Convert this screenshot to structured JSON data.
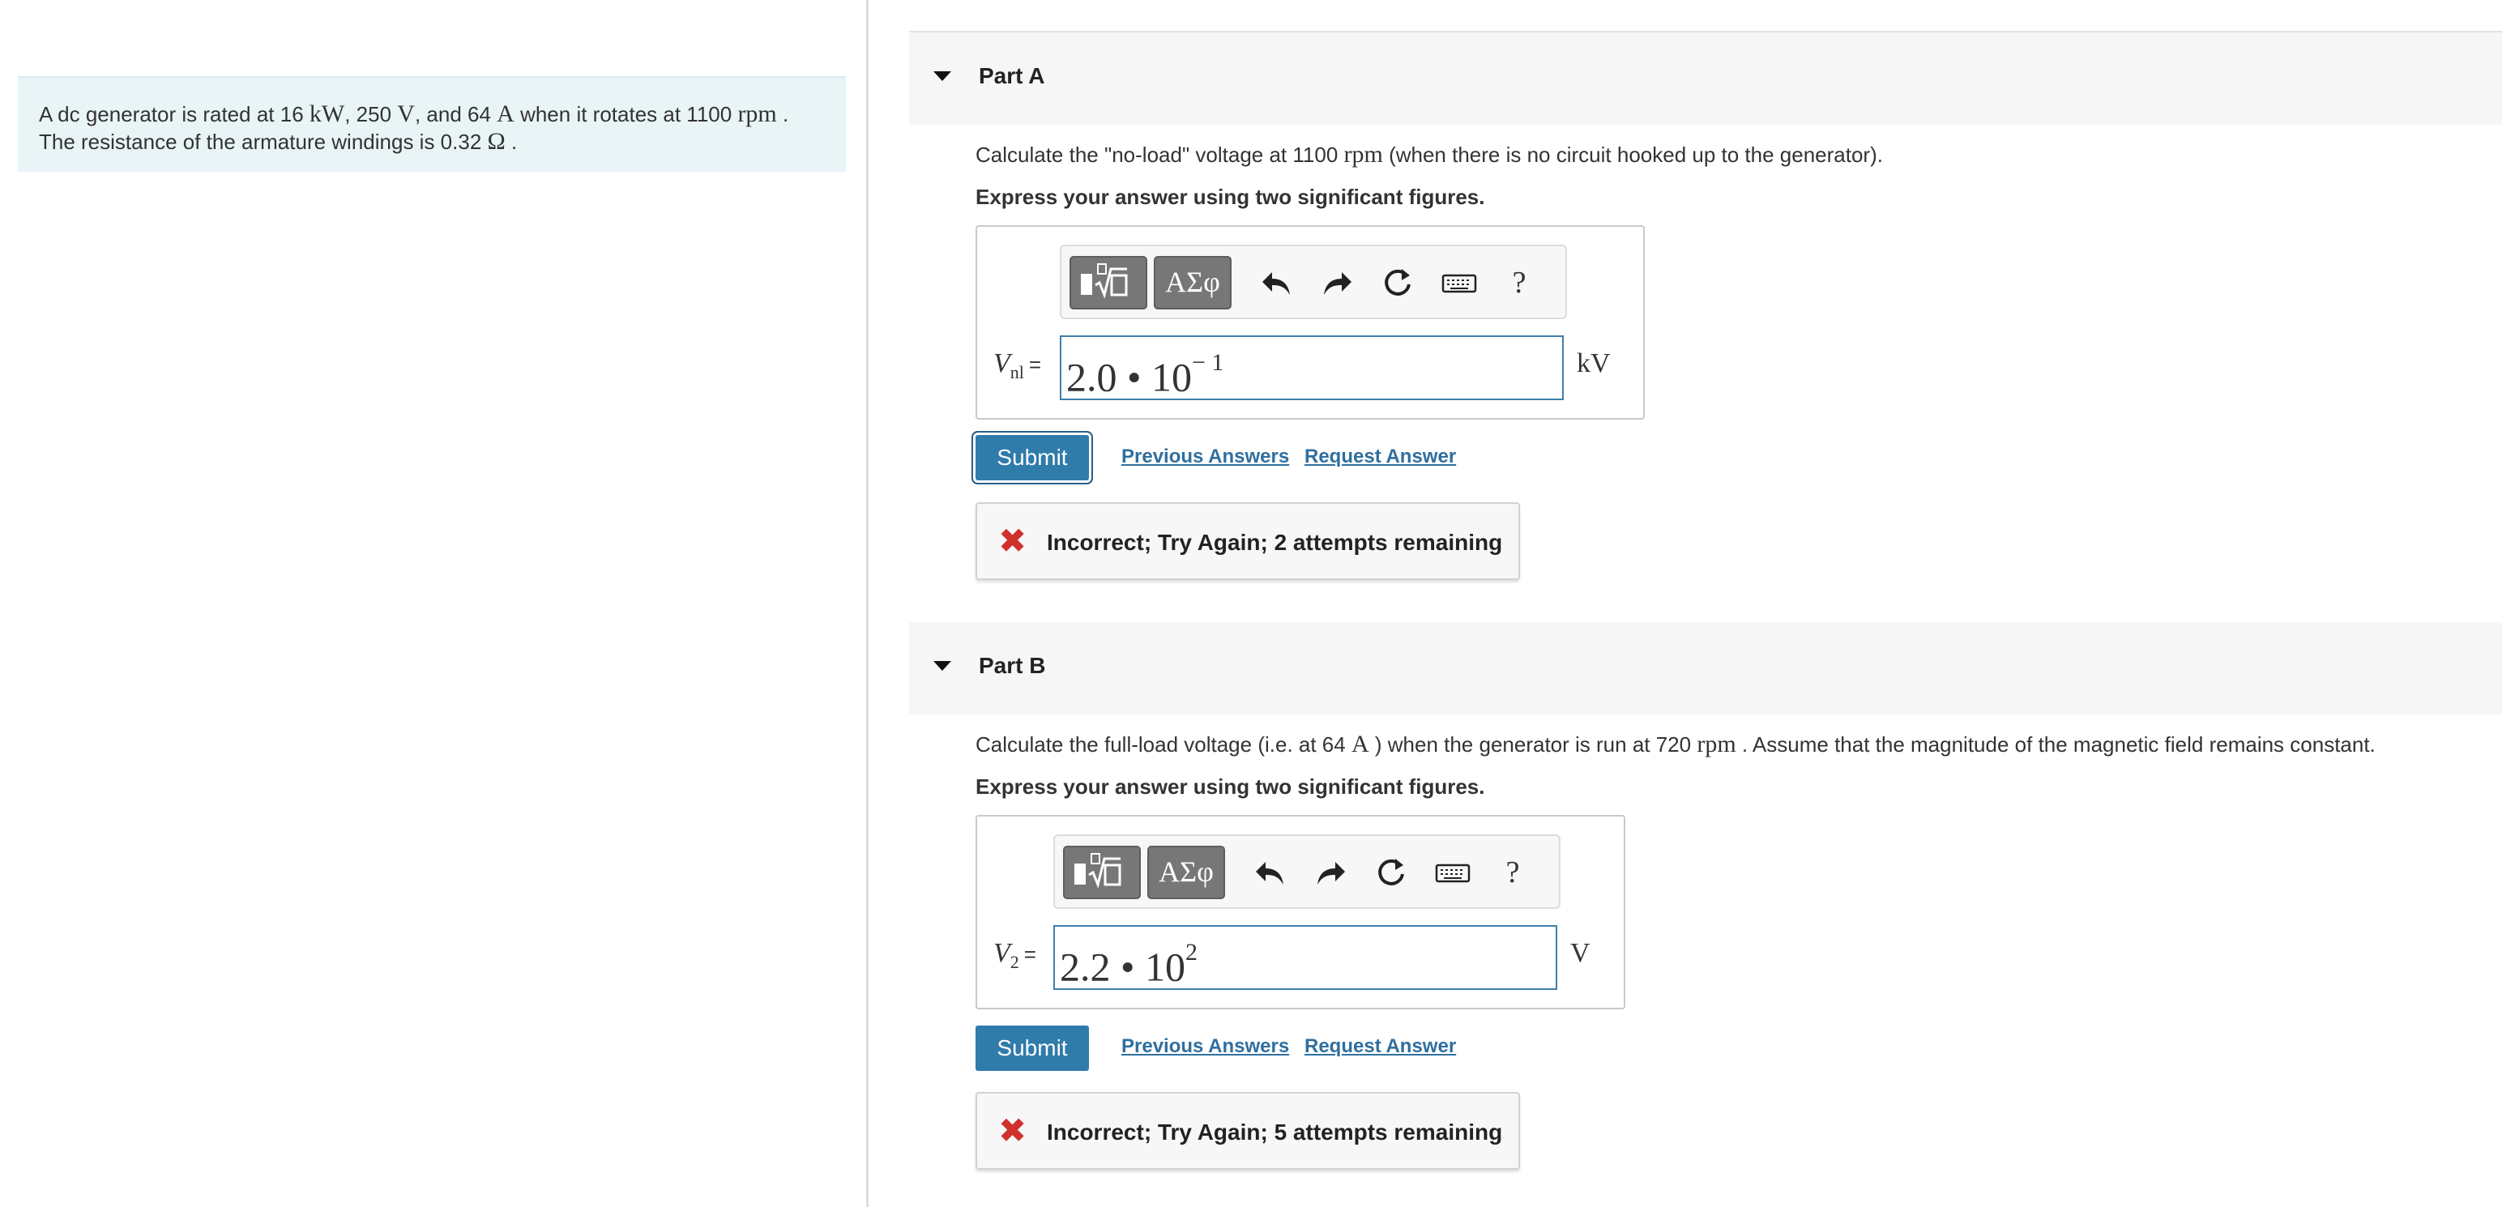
{
  "problem": {
    "line1_pre": "A dc generator is rated at 16",
    "power_unit": "kW",
    "line1_mid1": ", 250",
    "voltage_unit": "V",
    "line1_mid2": ", and 64",
    "current_unit": "A",
    "line1_mid3": " when it rotates at 1100",
    "speed_unit": "rpm",
    "line1_end": ".",
    "line2_pre": "The resistance of the armature windings is 0.32",
    "resistance_unit": "Ω",
    "line2_end": "."
  },
  "part_a": {
    "title": "Part A",
    "question_pre": "Calculate the \"no-load\" voltage at 1100",
    "question_unit": "rpm",
    "question_post": " (when there is no circuit hooked up to the generator).",
    "instruction": "Express your answer using two significant figures.",
    "toolbar": {
      "templates_icon": "templates-icon",
      "greek_label": "ΑΣφ",
      "undo": "undo-icon",
      "redo": "redo-icon",
      "reset": "reset-icon",
      "keyboard": "keyboard-icon",
      "help": "?"
    },
    "var_symbol": "V",
    "var_sub": "nl",
    "equals": "=",
    "answer_mantissa": "2.0 • 10",
    "answer_exponent": "− 1",
    "unit": "kV",
    "submit": "Submit",
    "previous_answers": "Previous Answers",
    "request_answer": "Request Answer",
    "feedback_icon": "✖",
    "feedback": "Incorrect; Try Again; 2 attempts remaining"
  },
  "part_b": {
    "title": "Part B",
    "question_pre": "Calculate the full-load voltage (i.e. at 64",
    "question_unit1": "A",
    "question_mid": ") when the generator is run at 720",
    "question_unit2": "rpm",
    "question_post": ". Assume that the magnitude of the magnetic field remains constant.",
    "instruction": "Express your answer using two significant figures.",
    "toolbar": {
      "templates_icon": "templates-icon",
      "greek_label": "ΑΣφ",
      "undo": "undo-icon",
      "redo": "redo-icon",
      "reset": "reset-icon",
      "keyboard": "keyboard-icon",
      "help": "?"
    },
    "var_symbol": "V",
    "var_sub": "2",
    "equals": "=",
    "answer_mantissa": "2.2 • 10",
    "answer_exponent": "2",
    "unit": "V",
    "submit": "Submit",
    "previous_answers": "Previous Answers",
    "request_answer": "Request Answer",
    "feedback_icon": "✖",
    "feedback": "Incorrect; Try Again; 5 attempts remaining"
  },
  "colors": {
    "problem_bg": "#e9f4f6",
    "submit_bg": "#2f7baa",
    "link": "#2f6f9f",
    "error": "#d0312d",
    "input_border": "#3d7fab"
  }
}
